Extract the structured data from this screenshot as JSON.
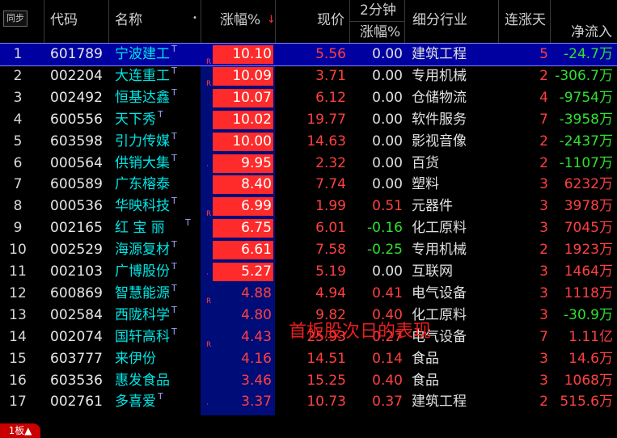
{
  "header": {
    "sync": "同步",
    "code": "代码",
    "name": "名称",
    "sort_dot": "•",
    "pct": "涨幅%",
    "sort_arrow": "↓",
    "price": "现价",
    "min2_top": "2分钟",
    "min2_bottom": "涨幅%",
    "industry": "细分行业",
    "streak": "连涨天",
    "netflow": "净流入"
  },
  "colors": {
    "up": "#ff4040",
    "down": "#30e030",
    "flat": "#e0e0e0",
    "highlight_box": "#ff2a2a",
    "selected_row": "#0000a0"
  },
  "rows": [
    {
      "idx": "1",
      "code": "601789",
      "name": "宁波建工",
      "sup": "T",
      "mark": "R",
      "pct": "10.10",
      "price": "5.56",
      "m2": "0.00",
      "industry": "建筑工程",
      "streak": "5",
      "flow": "-24.7万",
      "limit": true,
      "selected": true
    },
    {
      "idx": "2",
      "code": "002204",
      "name": "大连重工",
      "sup": "T",
      "mark": "R",
      "pct": "10.09",
      "price": "3.71",
      "m2": "0.00",
      "industry": "专用机械",
      "streak": "2",
      "flow": "-306.7万",
      "limit": true
    },
    {
      "idx": "3",
      "code": "002492",
      "name": "恒基达鑫",
      "sup": "T",
      "mark": "",
      "pct": "10.07",
      "price": "6.12",
      "m2": "0.00",
      "industry": "仓储物流",
      "streak": "4",
      "flow": "-9754万",
      "limit": true
    },
    {
      "idx": "4",
      "code": "600556",
      "name": "天下秀",
      "sup": "T",
      "mark": "",
      "pct": "10.02",
      "price": "19.77",
      "m2": "0.00",
      "industry": "软件服务",
      "streak": "7",
      "flow": "-3958万",
      "limit": true
    },
    {
      "idx": "5",
      "code": "603598",
      "name": "引力传媒",
      "sup": "T",
      "mark": "",
      "pct": "10.00",
      "price": "14.63",
      "m2": "0.00",
      "industry": "影视音像",
      "streak": "2",
      "flow": "-2437万",
      "limit": true
    },
    {
      "idx": "6",
      "code": "000564",
      "name": "供销大集",
      "sup": "T",
      "mark": "·",
      "pct": "9.95",
      "price": "2.32",
      "m2": "0.00",
      "industry": "百货",
      "streak": "2",
      "flow": "-1107万",
      "limit": true
    },
    {
      "idx": "7",
      "code": "600589",
      "name": "广东榕泰",
      "sup": "",
      "mark": "",
      "pct": "8.40",
      "price": "7.74",
      "m2": "0.00",
      "industry": "塑料",
      "streak": "3",
      "flow": "6232万",
      "limit": true
    },
    {
      "idx": "8",
      "code": "000536",
      "name": "华映科技",
      "sup": "T",
      "mark": "R",
      "pct": "6.99",
      "price": "1.99",
      "m2": "0.51",
      "industry": "元器件",
      "streak": "3",
      "flow": "3978万",
      "limit": true
    },
    {
      "idx": "9",
      "code": "002165",
      "name": "红 宝 丽",
      "sup": "T",
      "mark": "",
      "pct": "6.75",
      "price": "6.01",
      "m2": "-0.16",
      "industry": "化工原料",
      "streak": "3",
      "flow": "7045万",
      "limit": true
    },
    {
      "idx": "10",
      "code": "002529",
      "name": "海源复材",
      "sup": "T",
      "mark": "",
      "pct": "6.61",
      "price": "7.58",
      "m2": "-0.25",
      "industry": "专用机械",
      "streak": "2",
      "flow": "1923万",
      "limit": true
    },
    {
      "idx": "11",
      "code": "002103",
      "name": "广博股份",
      "sup": "T",
      "mark": "·",
      "pct": "5.27",
      "price": "5.19",
      "m2": "0.00",
      "industry": "互联网",
      "streak": "3",
      "flow": "1464万",
      "limit": true
    },
    {
      "idx": "12",
      "code": "600869",
      "name": "智慧能源",
      "sup": "T",
      "mark": "R",
      "pct": "4.88",
      "price": "4.94",
      "m2": "0.41",
      "industry": "电气设备",
      "streak": "3",
      "flow": "1118万",
      "limit": false
    },
    {
      "idx": "13",
      "code": "002584",
      "name": "西陇科学",
      "sup": "T",
      "mark": "",
      "pct": "4.80",
      "price": "9.82",
      "m2": "0.40",
      "industry": "化工原料",
      "streak": "3",
      "flow": "-30.9万",
      "limit": false
    },
    {
      "idx": "14",
      "code": "002074",
      "name": "国轩高科",
      "sup": "T",
      "mark": "R",
      "pct": "4.43",
      "price": "25.93",
      "m2": "0.27",
      "industry": "电气设备",
      "streak": "7",
      "flow": "1.11亿",
      "limit": false
    },
    {
      "idx": "15",
      "code": "603777",
      "name": "来伊份",
      "sup": "",
      "mark": "",
      "pct": "4.16",
      "price": "14.51",
      "m2": "0.14",
      "industry": "食品",
      "streak": "3",
      "flow": "14.6万",
      "limit": false
    },
    {
      "idx": "16",
      "code": "603536",
      "name": "惠发食品",
      "sup": "",
      "mark": "",
      "pct": "3.46",
      "price": "15.25",
      "m2": "0.40",
      "industry": "食品",
      "streak": "3",
      "flow": "1068万",
      "limit": false
    },
    {
      "idx": "17",
      "code": "002761",
      "name": "多喜爱",
      "sup": "T",
      "mark": "·",
      "pct": "3.37",
      "price": "10.73",
      "m2": "0.37",
      "industry": "建筑工程",
      "streak": "2",
      "flow": "515.6万",
      "limit": false
    }
  ],
  "overlay_text": "首板股次日的表现",
  "board_tab": "1板▲"
}
